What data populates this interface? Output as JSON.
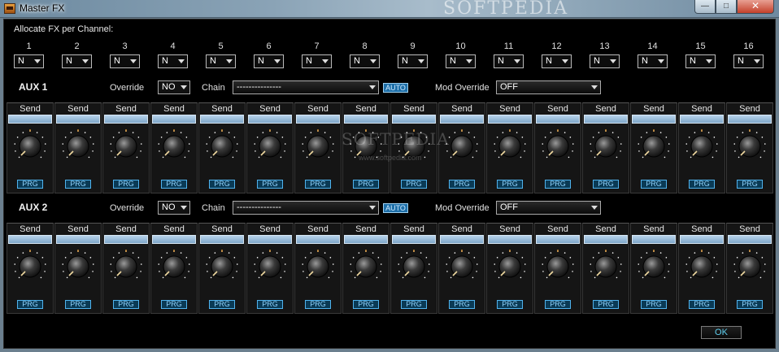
{
  "window": {
    "title": "Master FX",
    "watermark": "SOFTPEDIA",
    "controls": {
      "minimize": "—",
      "maximize": "□",
      "close": "✕"
    }
  },
  "allocate_label": "Allocate FX per Channel:",
  "channels": [
    {
      "num": "1",
      "value": "N"
    },
    {
      "num": "2",
      "value": "N"
    },
    {
      "num": "3",
      "value": "N"
    },
    {
      "num": "4",
      "value": "N"
    },
    {
      "num": "5",
      "value": "N"
    },
    {
      "num": "6",
      "value": "N"
    },
    {
      "num": "7",
      "value": "N"
    },
    {
      "num": "8",
      "value": "N"
    },
    {
      "num": "9",
      "value": "N"
    },
    {
      "num": "10",
      "value": "N"
    },
    {
      "num": "11",
      "value": "N"
    },
    {
      "num": "12",
      "value": "N"
    },
    {
      "num": "13",
      "value": "N"
    },
    {
      "num": "14",
      "value": "N"
    },
    {
      "num": "15",
      "value": "N"
    },
    {
      "num": "16",
      "value": "N"
    }
  ],
  "aux_sections": [
    {
      "label": "AUX 1",
      "override_label": "Override",
      "override_value": "NO",
      "chain_label": "Chain",
      "chain_value": "---------------",
      "auto_label": "AUTO",
      "mod_override_label": "Mod Override",
      "mod_override_value": "OFF",
      "send_label": "Send",
      "prg_label": "PRG"
    },
    {
      "label": "AUX 2",
      "override_label": "Override",
      "override_value": "NO",
      "chain_label": "Chain",
      "chain_value": "---------------",
      "auto_label": "AUTO",
      "mod_override_label": "Mod Override",
      "mod_override_value": "OFF",
      "send_label": "Send",
      "prg_label": "PRG"
    }
  ],
  "center_watermark": "SOFTPEDIA",
  "center_watermark_url": "www.softpedia.com",
  "ok_label": "OK",
  "colors": {
    "accent": "#4fb3ee",
    "send_bar": "#9fc0de",
    "knob_marker": "#f0d9a0"
  }
}
